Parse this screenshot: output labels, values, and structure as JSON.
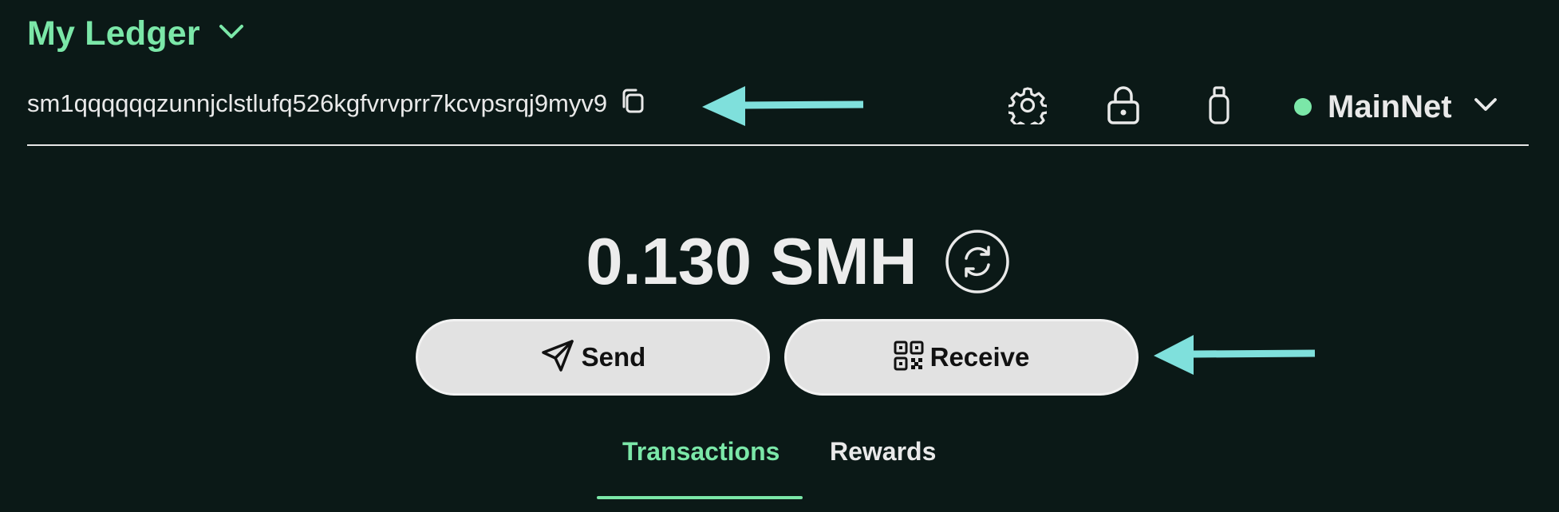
{
  "wallet": {
    "title": "My Ledger",
    "address": "sm1qqqqqqzunnjclstlufq526kgfvrvprr7kcvpsrqj9myv9"
  },
  "toolbar": {
    "icons": [
      "gear-icon",
      "lock-icon",
      "usb-stick-icon"
    ]
  },
  "network": {
    "label": "MainNet",
    "status_color": "#7be7a8"
  },
  "balance": {
    "amount": "0.130 SMH"
  },
  "actions": {
    "send_label": "Send",
    "receive_label": "Receive"
  },
  "tabs": [
    {
      "label": "Transactions",
      "active": true
    },
    {
      "label": "Rewards",
      "active": false
    }
  ],
  "colors": {
    "background": "#0b1917",
    "accent": "#7be7a8",
    "button_bg": "#e2e2e2",
    "annotation_arrow": "#7fe0dc"
  }
}
